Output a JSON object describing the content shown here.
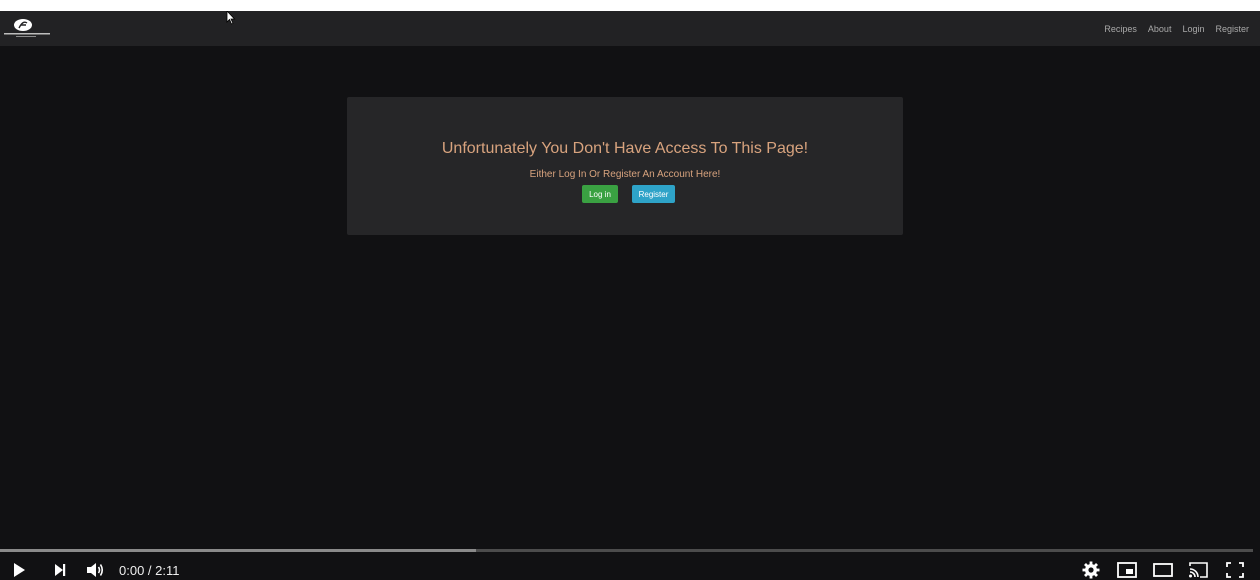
{
  "nav": {
    "links": [
      "Recipes",
      "About",
      "Login",
      "Register"
    ]
  },
  "access": {
    "title": "Unfortunately You Don't Have Access To This Page!",
    "subtitle": "Either Log In Or Register An Account Here!",
    "login_label": "Log in",
    "register_label": "Register"
  },
  "player": {
    "current_time": "0:00",
    "separator": " / ",
    "duration": "2:11",
    "buffered_fraction": 0.38,
    "play_icon": "play-icon",
    "next_icon": "next-icon",
    "volume_icon": "volume-icon",
    "settings_icon": "gear-icon",
    "miniplayer_icon": "miniplayer-icon",
    "theater_icon": "theater-icon",
    "cast_icon": "cast-icon",
    "fullscreen_icon": "fullscreen-icon"
  },
  "colors": {
    "accent_text": "#d8a37e",
    "login_button": "#3aa142",
    "register_button": "#2ea3c8"
  }
}
